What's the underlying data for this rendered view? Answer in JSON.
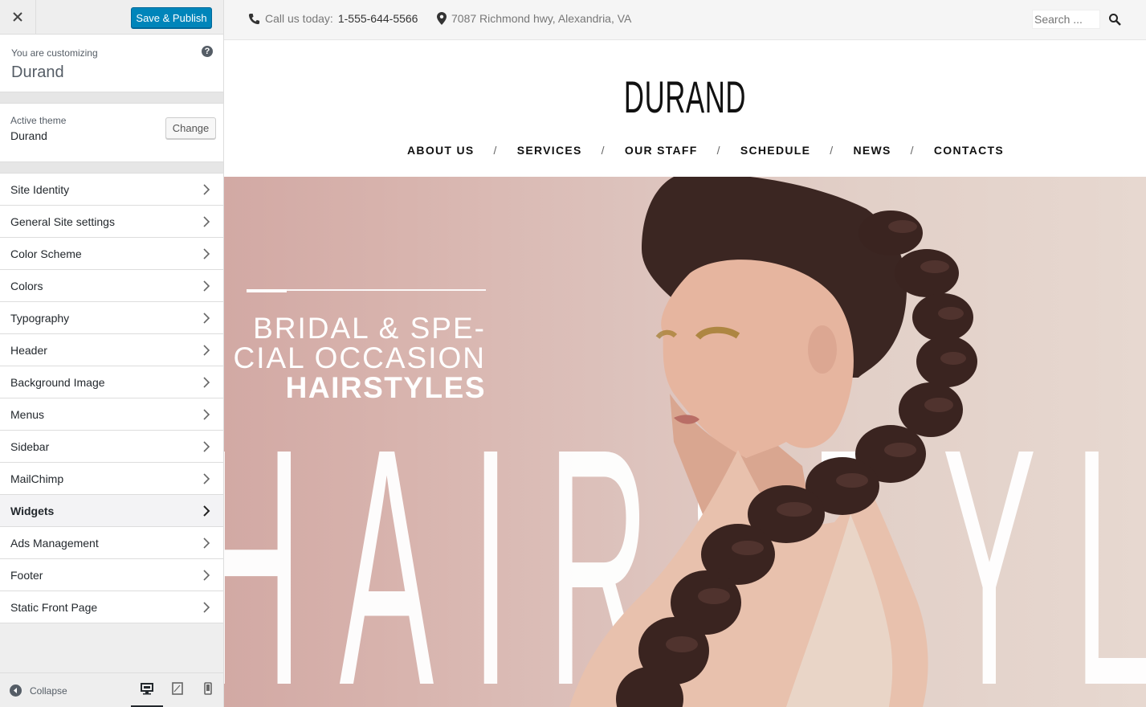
{
  "sidebar": {
    "save_label": "Save & Publish",
    "customizing_label": "You are customizing",
    "site_name": "Durand",
    "active_theme_label": "Active theme",
    "active_theme_name": "Durand",
    "change_label": "Change",
    "items": [
      {
        "label": "Site Identity"
      },
      {
        "label": "General Site settings"
      },
      {
        "label": "Color Scheme"
      },
      {
        "label": "Colors"
      },
      {
        "label": "Typography"
      },
      {
        "label": "Header"
      },
      {
        "label": "Background Image"
      },
      {
        "label": "Menus"
      },
      {
        "label": "Sidebar"
      },
      {
        "label": "MailChimp"
      },
      {
        "label": "Widgets"
      },
      {
        "label": "Ads Management"
      },
      {
        "label": "Footer"
      },
      {
        "label": "Static Front Page"
      }
    ],
    "collapse_label": "Collapse"
  },
  "preview": {
    "topbar": {
      "call_label": "Call us today:",
      "phone": "1-555-644-5566",
      "address": "7087 Richmond hwy, Alexandria, VA",
      "search_placeholder": "Search ..."
    },
    "logo": "DURAND",
    "nav": [
      "ABOUT US",
      "SERVICES",
      "OUR STAFF",
      "SCHEDULE",
      "NEWS",
      "CONTACTS"
    ],
    "hero": {
      "line1": "BRIDAL & SPE-",
      "line2": "CIAL OCCASION",
      "line3": "HAIRSTYLES",
      "background_word": "HAIRSTYLING"
    }
  },
  "colors": {
    "primary_button": "#0085ba",
    "sidebar_bg": "#eeeeee",
    "hero_bg": "#d8b4ae"
  }
}
